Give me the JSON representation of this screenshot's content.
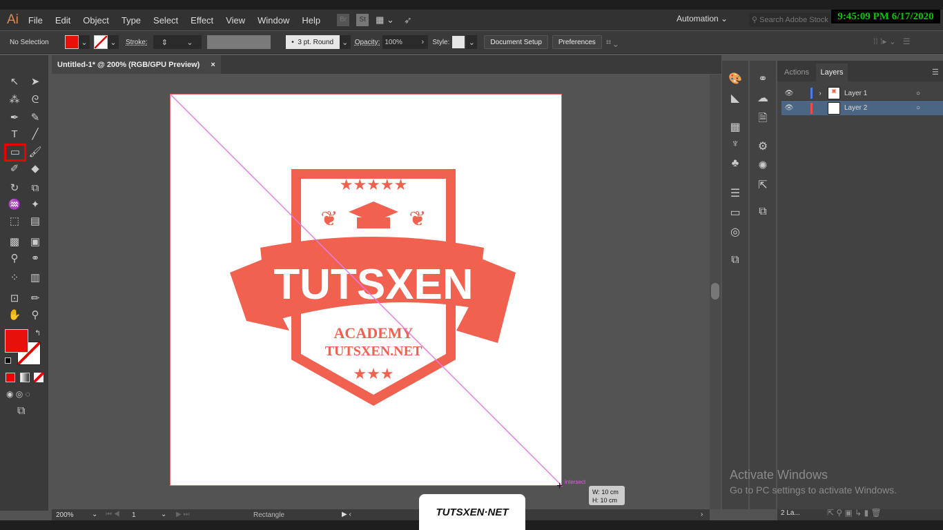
{
  "app": {
    "logo": "Ai",
    "menu": [
      "File",
      "Edit",
      "Object",
      "Type",
      "Select",
      "Effect",
      "View",
      "Window",
      "Help"
    ],
    "bridge": "Br",
    "stock": "St",
    "workspace": "Automation",
    "search_placeholder": "Search Adobe Stock"
  },
  "clock": "9:45:09 PM 6/17/2020",
  "control": {
    "selection": "No Selection",
    "stroke_label": "Stroke:",
    "brush": "3 pt. Round",
    "opacity_label": "Opacity:",
    "opacity": "100%",
    "style_label": "Style:",
    "doc_setup": "Document Setup",
    "preferences": "Preferences",
    "fill_color": "#e8100a"
  },
  "document": {
    "tab_title": "Untitled-1* @ 200% (RGB/GPU Preview)",
    "close": "×"
  },
  "canvas": {
    "smart_guide": "intersect",
    "width_readout": "W: 10 cm",
    "height_readout": "H: 10 cm"
  },
  "logo_art": {
    "title": "TUTSXEN",
    "line1": "ACADEMY",
    "line2": "TUTSXEN.NET",
    "color": "#f06150"
  },
  "status": {
    "zoom": "200%",
    "page": "1",
    "tool": "Rectangle"
  },
  "layers_panel": {
    "tabs": [
      "Actions",
      "Layers"
    ],
    "active_tab": "Layers",
    "layers": [
      {
        "name": "Layer 1",
        "color": "#4a7cf0",
        "expandable": true
      },
      {
        "name": "Layer 2",
        "color": "#f04a4a",
        "selected": true
      }
    ],
    "count": "2 La..."
  },
  "activate": {
    "title": "Activate Windows",
    "subtitle": "Go to PC settings to activate Windows."
  },
  "watermark": "TUTSXEN·NET"
}
